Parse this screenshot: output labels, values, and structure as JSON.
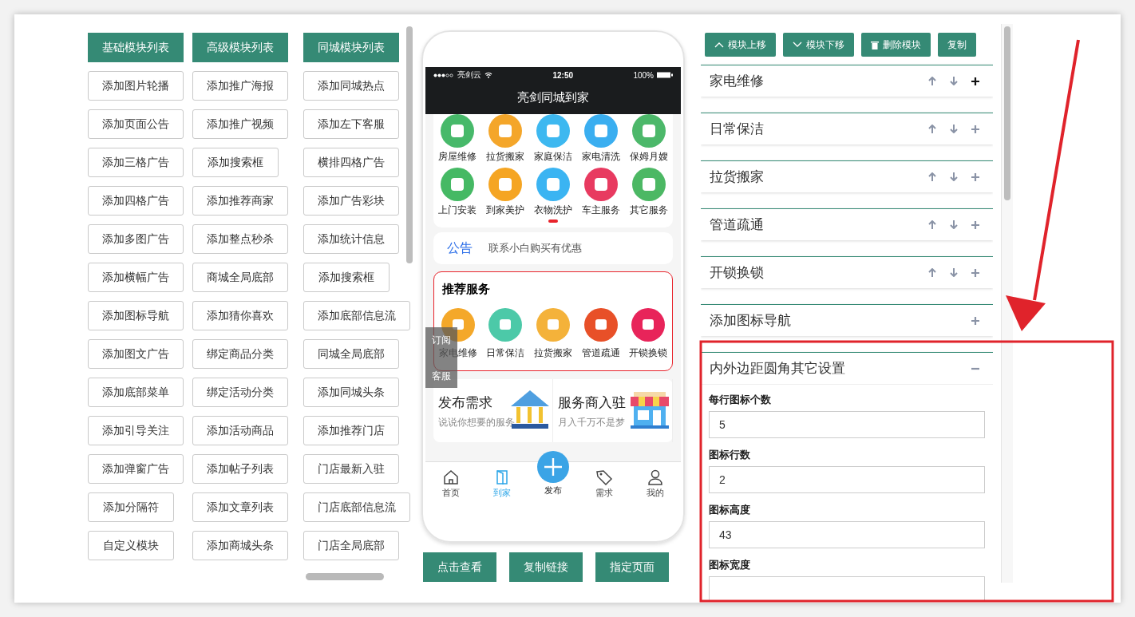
{
  "module_tabs": [
    "基础模块列表",
    "高级模块列表",
    "同城模块列表"
  ],
  "module_buttons": [
    "添加图片轮播",
    "添加推广海报",
    "添加同城热点",
    "添加页面公告",
    "添加推广视频",
    "添加左下客服",
    "添加三格广告",
    "添加搜索框",
    "横排四格广告",
    "添加四格广告",
    "添加推荐商家",
    "添加广告彩块",
    "添加多图广告",
    "添加整点秒杀",
    "添加统计信息",
    "添加横幅广告",
    "商城全局底部",
    "添加搜索框",
    "添加图标导航",
    "添加猜你喜欢",
    "添加底部信息流",
    "添加图文广告",
    "绑定商品分类",
    "同城全局底部",
    "添加底部菜单",
    "绑定活动分类",
    "添加同城头条",
    "添加引导关注",
    "添加活动商品",
    "添加推荐门店",
    "添加弹窗广告",
    "添加帖子列表",
    "门店最新入驻",
    "添加分隔符",
    "添加文章列表",
    "门店底部信息流",
    "自定义模块",
    "添加商城头条",
    "门店全局底部"
  ],
  "phone": {
    "status": {
      "carrier": "亮剑云",
      "time": "12:50",
      "battery": "100%"
    },
    "title": "亮剑同城到家",
    "services": [
      {
        "label": "房屋维修",
        "color": "#47b96a"
      },
      {
        "label": "拉货搬家",
        "color": "#f4a62a"
      },
      {
        "label": "家庭保洁",
        "color": "#3db8f0"
      },
      {
        "label": "家电清洗",
        "color": "#3aaef0"
      },
      {
        "label": "保姆月嫂",
        "color": "#4cb86a"
      },
      {
        "label": "上门安装",
        "color": "#45b964"
      },
      {
        "label": "到家美护",
        "color": "#f5a523"
      },
      {
        "label": "衣物洗护",
        "color": "#3bb4f2"
      },
      {
        "label": "车主服务",
        "color": "#e83a60"
      },
      {
        "label": "其它服务",
        "color": "#4cb864"
      }
    ],
    "notice": {
      "tag": "公告",
      "text": "联系小白购买有优惠"
    },
    "recommend": {
      "title": "推荐服务",
      "items": [
        {
          "label": "家电维修",
          "color": "#f4a82a"
        },
        {
          "label": "日常保洁",
          "color": "#4cc9a8"
        },
        {
          "label": "拉货搬家",
          "color": "#f4b23a"
        },
        {
          "label": "管道疏通",
          "color": "#e85028"
        },
        {
          "label": "开锁换锁",
          "color": "#e8245a"
        }
      ]
    },
    "side_float": [
      "订阅",
      "客服"
    ],
    "promos": [
      {
        "title": "发布需求",
        "subtitle": "说说你想要的服务"
      },
      {
        "title": "服务商入驻",
        "subtitle": "月入千万不是梦"
      }
    ],
    "tabbar": [
      {
        "label": "首页",
        "kind": "home",
        "selected": false
      },
      {
        "label": "到家",
        "kind": "door",
        "selected": true
      },
      {
        "label": "发布",
        "kind": "publish",
        "selected": false
      },
      {
        "label": "需求",
        "kind": "tag",
        "selected": false
      },
      {
        "label": "我的",
        "kind": "person",
        "selected": false
      }
    ]
  },
  "preview_buttons": [
    "点击查看",
    "复制链接",
    "指定页面"
  ],
  "toolbar": [
    {
      "label": "模块上移",
      "kind": "up"
    },
    {
      "label": "模块下移",
      "kind": "down"
    },
    {
      "label": "删除模块",
      "kind": "delete"
    },
    {
      "label": "复制",
      "kind": "plain"
    }
  ],
  "panels": [
    {
      "title": "家电维修",
      "movable": true,
      "expanded": false,
      "hovered": true
    },
    {
      "title": "日常保洁",
      "movable": true,
      "expanded": false,
      "hovered": false
    },
    {
      "title": "拉货搬家",
      "movable": true,
      "expanded": false,
      "hovered": false
    },
    {
      "title": "管道疏通",
      "movable": true,
      "expanded": false,
      "hovered": false
    },
    {
      "title": "开锁换锁",
      "movable": true,
      "expanded": false,
      "hovered": false
    },
    {
      "title": "添加图标导航",
      "movable": false,
      "expanded": false,
      "hovered": false
    },
    {
      "title": "内外边距圆角其它设置",
      "movable": false,
      "expanded": true,
      "hovered": false,
      "fields": [
        {
          "label": "每行图标个数",
          "value": "5"
        },
        {
          "label": "图标行数",
          "value": "2"
        },
        {
          "label": "图标高度",
          "value": "43"
        },
        {
          "label": "图标宽度"
        }
      ]
    }
  ]
}
